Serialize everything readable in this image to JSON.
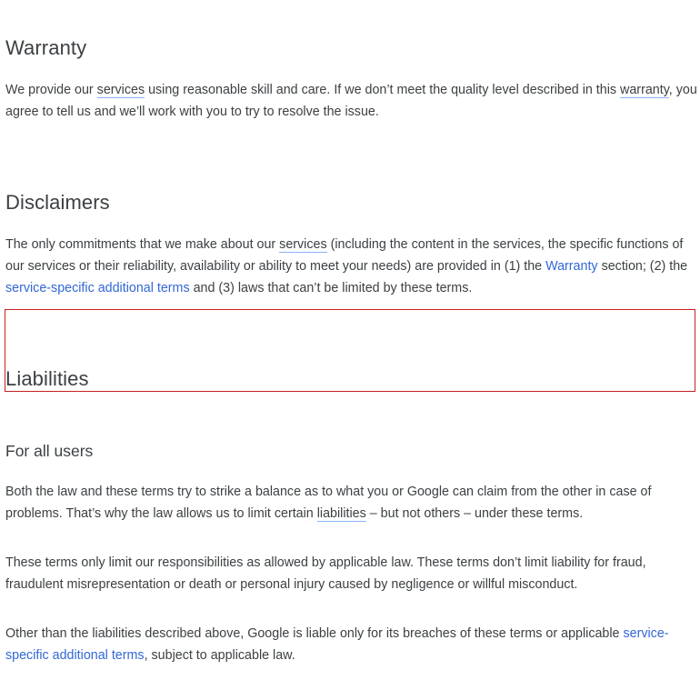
{
  "warranty": {
    "heading": "Warranty",
    "p1": {
      "t1": "We provide our ",
      "services": "services",
      "t2": " using reasonable skill and care. If we don’t meet the quality level described in this ",
      "warranty": "warranty",
      "t3": ", you agree to tell us and we’ll work with you to try to resolve the issue."
    }
  },
  "disclaimers": {
    "heading": "Disclaimers",
    "p1": {
      "t1": "The only commitments that we make about our ",
      "services": "services",
      "t2": " (including the content in the services, the specific functions of our services or their reliability, availability or ability to meet your needs) are provided in (1) the ",
      "warranty_link": "Warranty",
      "t3": " section; (2) the ",
      "additional_terms_link": "service-specific additional terms",
      "t4": " and (3) laws that can’t be limited by these terms."
    }
  },
  "liabilities": {
    "heading": "Liabilities",
    "subheading": "For all users",
    "p1": {
      "t1": "Both the law and these terms try to strike a balance as to what you or Google can claim from the other in case of problems. That’s why the law allows us to limit certain ",
      "liabilities": "liabilities",
      "t2": " – but not others – under these terms."
    },
    "p2": "These terms only limit our responsibilities as allowed by applicable law. These terms don’t limit liability for fraud, fraudulent misrepresentation or death or personal injury caused by negligence or willful misconduct.",
    "p3": {
      "t1": "Other than the liabilities described above, Google is liable only for its breaches of these terms or applicable ",
      "additional_terms_link": "service-specific additional terms",
      "t2": ", subject to applicable law."
    }
  },
  "colors": {
    "text": "#3c4043",
    "link": "#3367d6",
    "term_underline": "#8ab4f8",
    "highlight_border": "#c5221f"
  }
}
